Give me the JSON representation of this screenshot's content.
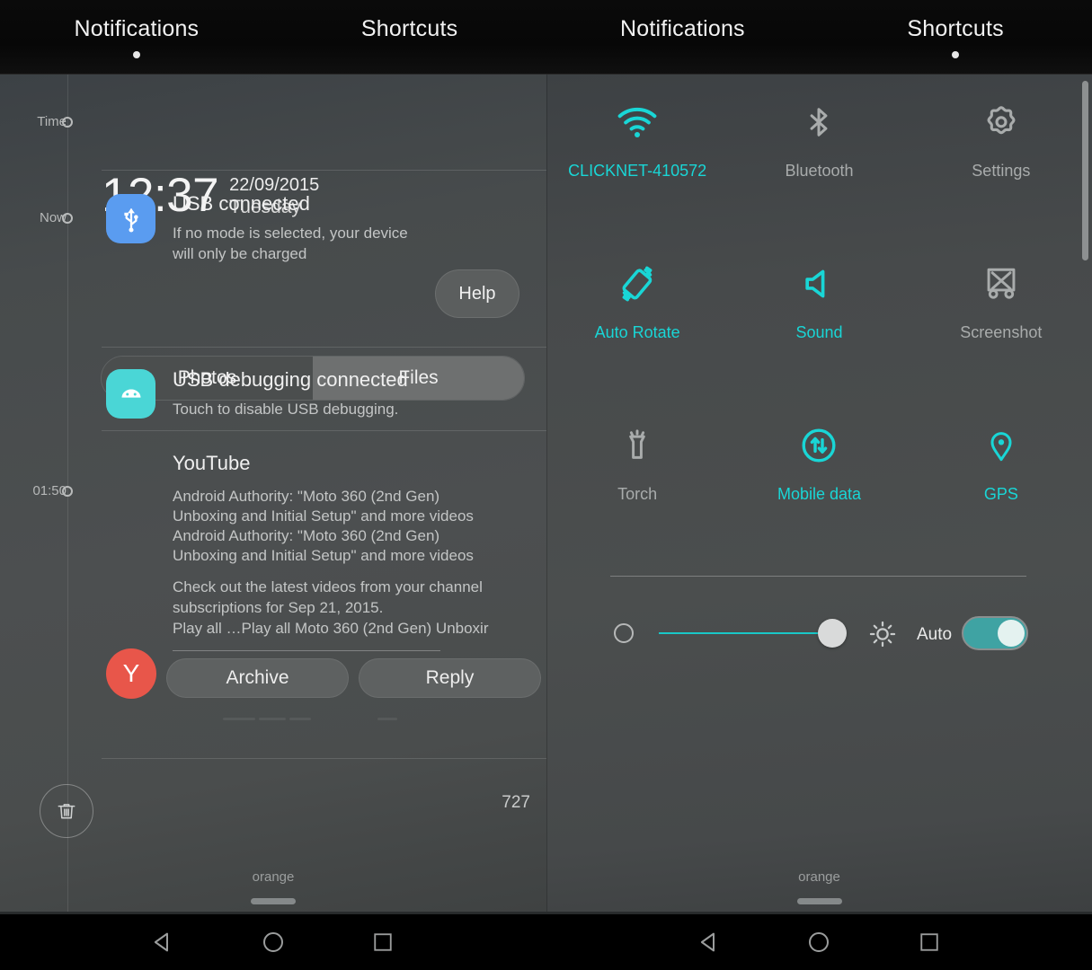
{
  "header": {
    "left_panel": {
      "tabs": [
        {
          "label": "Notifications",
          "active": true
        },
        {
          "label": "Shortcuts",
          "active": false
        }
      ]
    },
    "right_panel": {
      "tabs": [
        {
          "label": "Notifications",
          "active": false
        },
        {
          "label": "Shortcuts",
          "active": true
        }
      ]
    }
  },
  "timeline": {
    "items": [
      {
        "label": "Time"
      },
      {
        "label": "Now"
      },
      {
        "label": "01:50"
      }
    ]
  },
  "clock": {
    "time": "12:37",
    "date": "22/09/2015",
    "day": "Tuesday"
  },
  "notifications": [
    {
      "id": "usb-connected",
      "icon": "usb-icon",
      "icon_bg": "#5a9cf0",
      "title": "USB connected",
      "body": "If no mode is selected, your device will only be charged",
      "action": {
        "label": "Help"
      },
      "segments": [
        {
          "label": "Photos",
          "selected": false
        },
        {
          "label": "Files",
          "selected": true
        }
      ]
    },
    {
      "id": "usb-debugging",
      "icon": "android-icon",
      "icon_bg": "#4ad6d6",
      "title": "USB debugging connected",
      "body": "Touch to disable USB debugging."
    },
    {
      "id": "youtube",
      "icon": "youtube-avatar",
      "avatar_letter": "Y",
      "avatar_bg": "#e8564a",
      "title": "YouTube",
      "lines": [
        "Android Authority: \"Moto 360 (2nd Gen)",
        "Unboxing and Initial Setup\" and more videos",
        "Android Authority: \"Moto 360 (2nd Gen)",
        "Unboxing and Initial Setup\" and more videos"
      ],
      "expanded_lines": [
        "Check out the latest videos from your channel",
        "subscriptions for Sep 21, 2015.",
        "Play all  …Play all   Moto 360 (2nd Gen) Unboxir"
      ],
      "buttons": [
        {
          "label": "Archive"
        },
        {
          "label": "Reply"
        }
      ],
      "count": "727"
    }
  ],
  "trash_button": {
    "icon": "trash-icon"
  },
  "shortcuts": {
    "accent_on": "#19d6d6",
    "accent_off": "#a9acac",
    "rows": [
      [
        {
          "icon": "wifi-icon",
          "label": "CLICKNET-410572",
          "active": true
        },
        {
          "icon": "bluetooth-icon",
          "label": "Bluetooth",
          "active": false
        },
        {
          "icon": "gear-icon",
          "label": "Settings",
          "active": false
        }
      ],
      [
        {
          "icon": "auto-rotate-icon",
          "label": "Auto Rotate",
          "active": true
        },
        {
          "icon": "sound-icon",
          "label": "Sound",
          "active": true
        },
        {
          "icon": "screenshot-icon",
          "label": "Screenshot",
          "active": false
        }
      ],
      [
        {
          "icon": "torch-icon",
          "label": "Torch",
          "active": false
        },
        {
          "icon": "mobile-data-icon",
          "label": "Mobile data",
          "active": true
        },
        {
          "icon": "gps-icon",
          "label": "GPS",
          "active": true
        }
      ]
    ]
  },
  "brightness": {
    "min_icon": "brightness-low-icon",
    "max_icon": "brightness-high-icon",
    "value_percent": 100,
    "auto_label": "Auto",
    "auto_enabled": true
  },
  "footer": {
    "carrier_left": "orange",
    "carrier_right": "orange"
  },
  "navbar": {
    "buttons": [
      {
        "icon": "back-icon"
      },
      {
        "icon": "home-icon"
      },
      {
        "icon": "recents-icon"
      }
    ]
  }
}
